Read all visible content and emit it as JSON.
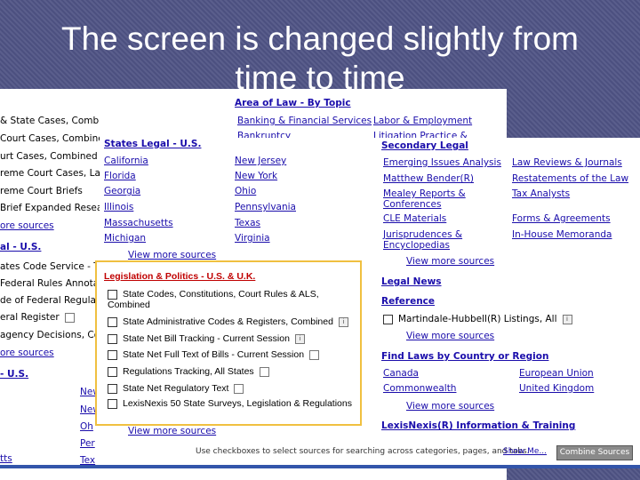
{
  "slide": {
    "title_line1": "The screen is changed slightly from",
    "title_line2": "time to time"
  },
  "left_column": {
    "items": [
      "& State Cases, Combined",
      "Court Cases, Combined",
      "urt Cases, Combined",
      "reme Court Cases, La",
      "reme Court Briefs",
      "Brief Expanded Resea",
      "ore sources",
      "al - U.S.",
      "ates Code Service - T",
      "Federal Rules Annotat",
      "de of Federal Regulat",
      "eral Register",
      "agency Decisions, Co",
      "ore sources",
      "- U.S.",
      "tts"
    ],
    "mid_fragments": [
      "New",
      "New",
      "Oh",
      "Per",
      "Tex"
    ]
  },
  "area_of_law": {
    "heading": "Area of Law - By Topic",
    "banking": "Banking & Financial Services",
    "labor": "Labor & Employment",
    "bankruptcy": "Bankruptcy",
    "litigation": "Litigation Practice &"
  },
  "states_legal": {
    "heading": "States Legal - U.S.",
    "col1": [
      "California",
      "Florida",
      "Georgia",
      "Illinois",
      "Massachusetts",
      "Michigan"
    ],
    "col2": [
      "New Jersey",
      "New York",
      "Ohio",
      "Pennsylvania",
      "Texas",
      "Virginia"
    ],
    "more": "View more sources"
  },
  "legislation": {
    "heading": "Legislation & Politics - U.S. & U.K.",
    "items": [
      "State Codes, Constitutions, Court Rules & ALS, Combined",
      "State Administrative Codes & Registers, Combined",
      "State Net Bill Tracking - Current Session",
      "State Net Full Text of Bills - Current Session",
      "Regulations Tracking, All States",
      "State Net Regulatory Text",
      "LexisNexis 50 State Surveys, Legislation & Regulations"
    ],
    "more": "View more sources"
  },
  "secondary_legal": {
    "heading": "Secondary Legal",
    "col1": [
      "Emerging Issues Analysis",
      "Matthew Bender(R)",
      "Mealey Reports & Conferences",
      "CLE Materials",
      "Jurisprudences & Encyclopedias"
    ],
    "col2": [
      "Law Reviews & Journals",
      "Restatements of the Law",
      "Tax Analysts",
      "Forms & Agreements",
      "In-House Memoranda"
    ],
    "more": "View more sources"
  },
  "legal_news": {
    "heading": "Legal News"
  },
  "reference": {
    "heading": "Reference",
    "item": "Martindale-Hubbell(R) Listings, All",
    "more": "View more sources"
  },
  "find_laws": {
    "heading": "Find Laws by Country or Region",
    "col1": [
      "Canada",
      "Commonwealth"
    ],
    "col2": [
      "European Union",
      "United Kingdom"
    ],
    "more": "View more sources"
  },
  "information": {
    "heading": "LexisNexis(R) Information & Training"
  },
  "footer": {
    "hint": "Use checkboxes to select sources for searching across categories, pages, and tabs.",
    "show_more": "Show Me...",
    "combine": "Combine Sources"
  },
  "icons": {
    "info": "i"
  },
  "colors": {
    "link": "#1a0dab",
    "highlight_border": "#f0c040",
    "legislation_heading": "#c00000"
  }
}
